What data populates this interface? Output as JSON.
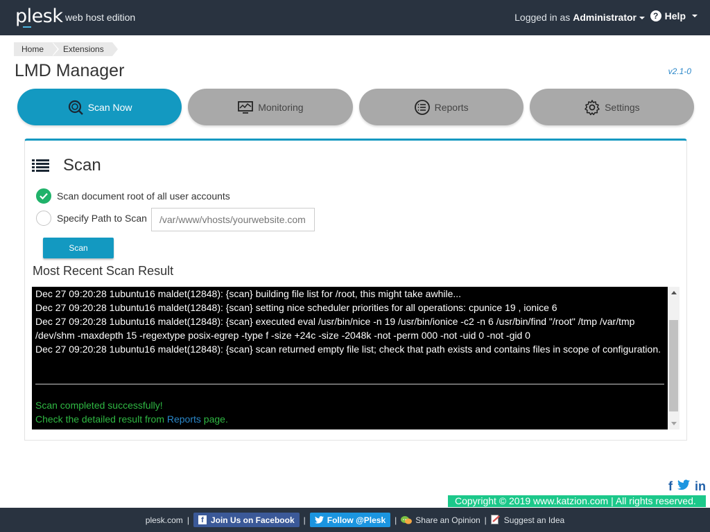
{
  "header": {
    "logo": "plesk",
    "edition": "web host edition",
    "logged_in_label": "Logged in as",
    "user": "Administrator",
    "help": "Help"
  },
  "breadcrumb": [
    "Home",
    "Extensions"
  ],
  "page": {
    "title": "LMD Manager",
    "version": "v2.1-0"
  },
  "tabs": [
    {
      "label": "Scan Now",
      "icon": "scan-icon",
      "active": true
    },
    {
      "label": "Monitoring",
      "icon": "monitor-icon",
      "active": false
    },
    {
      "label": "Reports",
      "icon": "reports-icon",
      "active": false
    },
    {
      "label": "Settings",
      "icon": "gear-icon",
      "active": false
    }
  ],
  "scan": {
    "title": "Scan",
    "option_all": "Scan document root of all user accounts",
    "option_path": "Specify Path to Scan",
    "path_placeholder": "/var/www/vhosts/yourwebsite.com",
    "button": "Scan",
    "result_title": "Most Recent Scan Result"
  },
  "console": {
    "lines": [
      "Dec 27 09:20:28 1ubuntu16 maldet(12848): {scan} building file list for /root, this might take awhile...",
      "Dec 27 09:20:28 1ubuntu16 maldet(12848): {scan} setting nice scheduler priorities for all operations: cpunice 19 , ionice 6",
      "Dec 27 09:20:28 1ubuntu16 maldet(12848): {scan} executed eval /usr/bin/nice -n 19 /usr/bin/ionice -c2 -n 6 /usr/bin/find \"/root\" /tmp /var/tmp /dev/shm -maxdepth 15 -regextype posix-egrep -type f -size +24c -size -2048k -not -perm 000 -not -uid 0 -not -gid 0",
      "Dec 27 09:20:28 1ubuntu16 maldet(12848): {scan} scan returned empty file list; check that path exists and contains files in scope of configuration."
    ],
    "success": "Scan completed successfully!",
    "detail_prefix": "Check the detailed result from",
    "detail_link": "Reports",
    "detail_suffix": "page."
  },
  "footer": {
    "copyright": "Copyright © 2019  www.katzion.com  | All rights reserved.",
    "social": {
      "facebook": "f",
      "linkedin": "in"
    },
    "plesk_link": "plesk.com",
    "facebook_btn": "Join Us on Facebook",
    "twitter_btn": "Follow @Plesk",
    "opinion": "Share an Opinion",
    "idea": "Suggest an Idea"
  },
  "colors": {
    "accent": "#1399c1",
    "topbar": "#293340",
    "success": "#20b26a",
    "copyright_bg": "#1cc88a"
  }
}
